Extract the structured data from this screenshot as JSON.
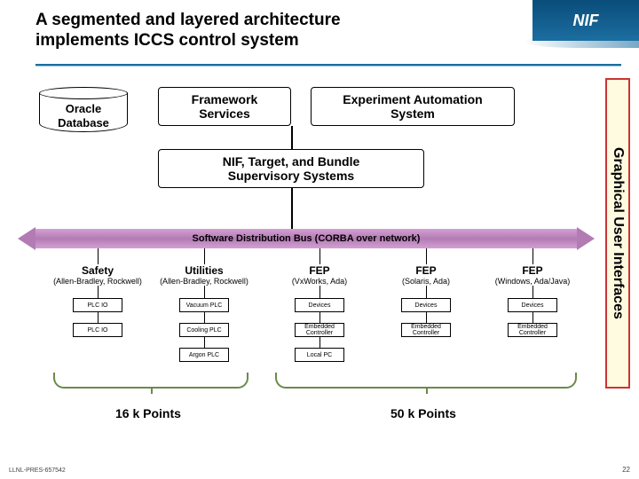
{
  "header": {
    "title": "A segmented and layered architecture implements ICCS control system",
    "badge": "NIF"
  },
  "top": {
    "oracle": "Oracle\nDatabase",
    "framework": "Framework\nServices",
    "experiment": "Experiment Automation\nSystem"
  },
  "supervisory": "NIF, Target, and Bundle\nSupervisory Systems",
  "bus": "Software Distribution Bus (CORBA over network)",
  "gui": "Graphical User Interfaces",
  "cols": {
    "safety": {
      "t1": "Safety",
      "t2": "(Allen-Bradley, Rockwell)"
    },
    "utilities": {
      "t1": "Utilities",
      "t2": "(Allen-Bradley, Rockwell)"
    },
    "fep1": {
      "t1": "FEP",
      "t2": "(VxWorks, Ada)"
    },
    "fep2": {
      "t1": "FEP",
      "t2": "(Solaris, Ada)"
    },
    "fep3": {
      "t1": "FEP",
      "t2": "(Windows, Ada/Java)"
    }
  },
  "chips": {
    "plcio": "PLC IO",
    "vacplc": "Vacuum PLC",
    "coolplc": "Cooling PLC",
    "argonplc": "Argon PLC",
    "devices": "Devices",
    "embctl": "Embedded Controller",
    "localpc": "Local PC"
  },
  "points": {
    "left": "16 k Points",
    "right": "50 k Points"
  },
  "footer": {
    "left": "LLNL-PRES-657542",
    "right": "22"
  }
}
